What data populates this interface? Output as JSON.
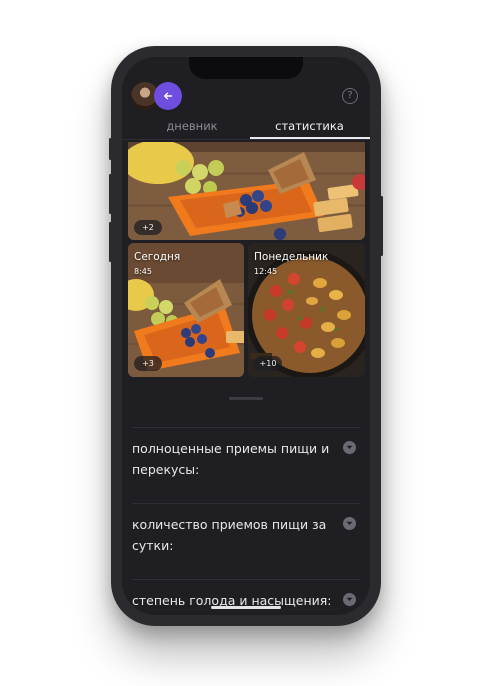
{
  "tabs": [
    {
      "label": "дневник",
      "active": false
    },
    {
      "label": "статистика",
      "active": true
    }
  ],
  "help": {
    "label": "?"
  },
  "photos": {
    "top": {
      "badge": "+2"
    },
    "left": {
      "title": "Сегодня",
      "time": "8:45",
      "badge": "+3"
    },
    "right": {
      "title": "Понедельник",
      "time": "12:45",
      "badge": "+10"
    }
  },
  "accordion": [
    {
      "label": "полноценные приемы пищи и перекусы:"
    },
    {
      "label": "количество приемов пищи за сутки:"
    },
    {
      "label": "степень голода и насыщения:"
    }
  ],
  "colors": {
    "accent": "#6f4dde",
    "background": "#1f1f23",
    "text": "#e8e8ec",
    "muted": "#8a8a92"
  },
  "icons": {
    "back": "arrow-left-icon",
    "help": "question-icon",
    "chevron": "chevron-down-icon"
  }
}
